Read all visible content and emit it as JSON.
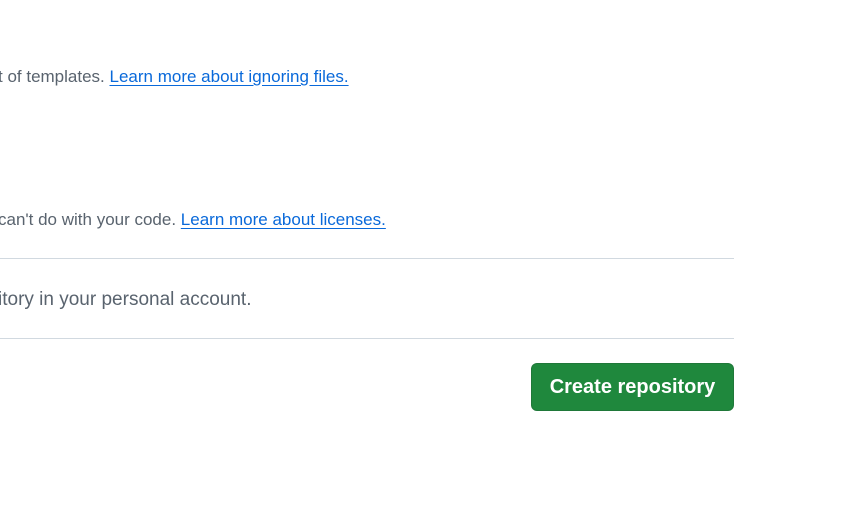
{
  "gitignore": {
    "help_text": "t of templates. ",
    "link_label": "Learn more about ignoring files."
  },
  "license": {
    "help_text": "can't do with your code. ",
    "link_label": "Learn more about licenses."
  },
  "summary": {
    "text": "itory in your personal account."
  },
  "actions": {
    "create_label": "Create repository"
  },
  "colors": {
    "accent_link": "#0969da",
    "primary_button": "#1f883d",
    "muted_text": "#59636e",
    "divider": "#d1d9e0"
  }
}
